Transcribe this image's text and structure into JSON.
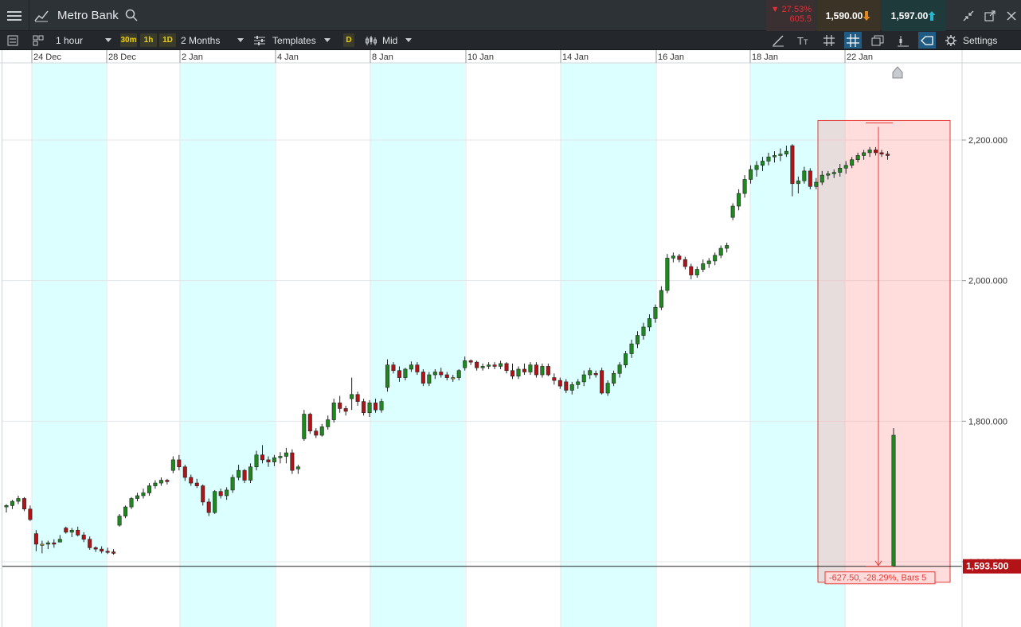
{
  "header": {
    "instrument": "Metro Bank",
    "change_pct": "▼ 27.53%",
    "change_abs": "605.5",
    "sell_price": "1,590.00",
    "buy_price": "1,597.00"
  },
  "toolbar": {
    "interval": "1 hour",
    "tf_30m": "30m",
    "tf_1h": "1h",
    "tf_1d": "1D",
    "range": "2 Months",
    "templates": "Templates",
    "d_badge": "D",
    "price_mode": "Mid",
    "settings": "Settings"
  },
  "chart_data": {
    "type": "candlestick",
    "x_tick_labels": [
      "24 Dec",
      "28 Dec",
      "2 Jan",
      "4 Jan",
      "8 Jan",
      "10 Jan",
      "14 Jan",
      "16 Jan",
      "18 Jan",
      "22 Jan"
    ],
    "y_tick_labels": [
      "2,200.000",
      "2,000.000",
      "1,800.000",
      "1,600.000"
    ],
    "y_ticks": [
      2200,
      2000,
      1800,
      1600
    ],
    "ylim": [
      1510,
      2310
    ],
    "current_price": 1593.5,
    "current_price_label": "1,593.500",
    "measurement": {
      "label": "-627.50, -28.29%, Bars 5",
      "from": 2221,
      "to": 1593.5
    },
    "colors": {
      "up": "#1e8a1e",
      "down": "#b31217",
      "doji": "#d4a020",
      "highlight": "#dcffff",
      "measure": "#e53935"
    },
    "candles": [
      [
        1678,
        1682,
        1670,
        1680
      ],
      [
        1680,
        1688,
        1675,
        1686
      ],
      [
        1686,
        1694,
        1682,
        1690
      ],
      [
        1690,
        1692,
        1672,
        1675
      ],
      [
        1675,
        1680,
        1658,
        1660
      ],
      [
        1640,
        1645,
        1615,
        1625
      ],
      [
        1625,
        1630,
        1612,
        1625
      ],
      [
        1625,
        1630,
        1618,
        1627
      ],
      [
        1627,
        1632,
        1620,
        1625
      ],
      [
        1628,
        1638,
        1630,
        1632
      ],
      [
        1648,
        1650,
        1640,
        1642
      ],
      [
        1642,
        1648,
        1635,
        1645
      ],
      [
        1645,
        1650,
        1636,
        1638
      ],
      [
        1638,
        1642,
        1628,
        1632
      ],
      [
        1632,
        1636,
        1617,
        1620
      ],
      [
        1620,
        1622,
        1614,
        1618
      ],
      [
        1618,
        1622,
        1612,
        1615
      ],
      [
        1615,
        1620,
        1611,
        1614
      ],
      [
        1614,
        1618,
        1610,
        1612
      ],
      [
        1652,
        1668,
        1650,
        1665
      ],
      [
        1665,
        1680,
        1662,
        1678
      ],
      [
        1678,
        1692,
        1675,
        1690
      ],
      [
        1690,
        1698,
        1686,
        1694
      ],
      [
        1694,
        1704,
        1690,
        1698
      ],
      [
        1698,
        1712,
        1694,
        1708
      ],
      [
        1708,
        1716,
        1704,
        1712
      ],
      [
        1712,
        1720,
        1708,
        1716
      ],
      [
        1716,
        1718,
        1710,
        1714
      ],
      [
        1730,
        1750,
        1726,
        1745
      ],
      [
        1745,
        1752,
        1730,
        1735
      ],
      [
        1735,
        1738,
        1715,
        1720
      ],
      [
        1720,
        1724,
        1708,
        1712
      ],
      [
        1712,
        1718,
        1705,
        1708
      ],
      [
        1708,
        1710,
        1680,
        1685
      ],
      [
        1685,
        1690,
        1665,
        1670
      ],
      [
        1670,
        1702,
        1668,
        1700
      ],
      [
        1700,
        1704,
        1690,
        1694
      ],
      [
        1694,
        1706,
        1688,
        1702
      ],
      [
        1702,
        1724,
        1698,
        1720
      ],
      [
        1720,
        1738,
        1716,
        1730
      ],
      [
        1730,
        1732,
        1712,
        1716
      ],
      [
        1716,
        1740,
        1712,
        1735
      ],
      [
        1735,
        1758,
        1730,
        1752
      ],
      [
        1752,
        1766,
        1740,
        1745
      ],
      [
        1745,
        1750,
        1735,
        1742
      ],
      [
        1742,
        1752,
        1736,
        1748
      ],
      [
        1748,
        1756,
        1740,
        1750
      ],
      [
        1750,
        1762,
        1740,
        1755
      ],
      [
        1755,
        1760,
        1725,
        1730
      ],
      [
        1732,
        1738,
        1725,
        1735
      ],
      [
        1775,
        1816,
        1772,
        1810
      ],
      [
        1810,
        1812,
        1782,
        1786
      ],
      [
        1786,
        1790,
        1776,
        1780
      ],
      [
        1780,
        1796,
        1778,
        1792
      ],
      [
        1792,
        1808,
        1788,
        1802
      ],
      [
        1802,
        1832,
        1798,
        1826
      ],
      [
        1826,
        1836,
        1812,
        1818
      ],
      [
        1818,
        1822,
        1808,
        1814
      ],
      [
        1832,
        1862,
        1816,
        1838
      ],
      [
        1838,
        1842,
        1822,
        1828
      ],
      [
        1828,
        1832,
        1808,
        1812
      ],
      [
        1812,
        1830,
        1806,
        1826
      ],
      [
        1826,
        1832,
        1812,
        1816
      ],
      [
        1816,
        1832,
        1812,
        1828
      ],
      [
        1848,
        1888,
        1842,
        1880
      ],
      [
        1880,
        1884,
        1868,
        1872
      ],
      [
        1872,
        1878,
        1856,
        1862
      ],
      [
        1862,
        1876,
        1858,
        1874
      ],
      [
        1874,
        1885,
        1870,
        1880
      ],
      [
        1880,
        1884,
        1866,
        1870
      ],
      [
        1870,
        1874,
        1850,
        1854
      ],
      [
        1854,
        1870,
        1850,
        1866
      ],
      [
        1866,
        1874,
        1860,
        1870
      ],
      [
        1870,
        1876,
        1862,
        1866
      ],
      [
        1866,
        1870,
        1858,
        1862
      ],
      [
        1862,
        1866,
        1856,
        1862
      ],
      [
        1862,
        1874,
        1858,
        1872
      ],
      [
        1876,
        1892,
        1872,
        1886
      ],
      [
        1886,
        1888,
        1880,
        1884
      ],
      [
        1884,
        1886,
        1872,
        1876
      ],
      [
        1876,
        1882,
        1872,
        1878
      ],
      [
        1878,
        1884,
        1874,
        1880
      ],
      [
        1880,
        1884,
        1874,
        1878
      ],
      [
        1878,
        1886,
        1874,
        1882
      ],
      [
        1882,
        1884,
        1868,
        1872
      ],
      [
        1872,
        1882,
        1860,
        1864
      ],
      [
        1864,
        1878,
        1860,
        1874
      ],
      [
        1874,
        1882,
        1866,
        1870
      ],
      [
        1870,
        1884,
        1866,
        1880
      ],
      [
        1880,
        1884,
        1862,
        1866
      ],
      [
        1866,
        1882,
        1862,
        1878
      ],
      [
        1878,
        1882,
        1864,
        1866
      ],
      [
        1862,
        1868,
        1852,
        1858
      ],
      [
        1858,
        1862,
        1846,
        1850
      ],
      [
        1856,
        1860,
        1840,
        1844
      ],
      [
        1844,
        1856,
        1838,
        1852
      ],
      [
        1852,
        1860,
        1846,
        1856
      ],
      [
        1856,
        1872,
        1850,
        1866
      ],
      [
        1866,
        1876,
        1860,
        1872
      ],
      [
        1868,
        1872,
        1862,
        1866
      ],
      [
        1872,
        1876,
        1838,
        1840
      ],
      [
        1840,
        1858,
        1836,
        1854
      ],
      [
        1854,
        1872,
        1850,
        1868
      ],
      [
        1868,
        1884,
        1862,
        1880
      ],
      [
        1880,
        1900,
        1876,
        1896
      ],
      [
        1896,
        1916,
        1890,
        1910
      ],
      [
        1910,
        1928,
        1904,
        1922
      ],
      [
        1922,
        1940,
        1916,
        1934
      ],
      [
        1934,
        1952,
        1928,
        1946
      ],
      [
        1946,
        1966,
        1940,
        1962
      ],
      [
        1962,
        1992,
        1958,
        1986
      ],
      [
        1986,
        2038,
        1982,
        2032
      ],
      [
        2032,
        2040,
        2026,
        2035
      ],
      [
        2035,
        2038,
        2026,
        2030
      ],
      [
        2030,
        2034,
        2016,
        2020
      ],
      [
        2020,
        2024,
        2002,
        2008
      ],
      [
        2008,
        2020,
        2004,
        2016
      ],
      [
        2016,
        2030,
        2012,
        2024
      ],
      [
        2024,
        2032,
        2018,
        2028
      ],
      [
        2028,
        2040,
        2022,
        2036
      ],
      [
        2036,
        2050,
        2032,
        2046
      ],
      [
        2046,
        2054,
        2040,
        2050
      ],
      [
        2090,
        2110,
        2086,
        2106
      ],
      [
        2106,
        2130,
        2100,
        2124
      ],
      [
        2124,
        2150,
        2118,
        2144
      ],
      [
        2144,
        2164,
        2138,
        2158
      ],
      [
        2158,
        2170,
        2148,
        2164
      ],
      [
        2164,
        2176,
        2156,
        2170
      ],
      [
        2170,
        2182,
        2164,
        2176
      ],
      [
        2176,
        2184,
        2168,
        2178
      ],
      [
        2178,
        2188,
        2170,
        2180
      ],
      [
        2180,
        2192,
        2176,
        2184
      ],
      [
        2192,
        2194,
        2120,
        2138
      ],
      [
        2138,
        2148,
        2124,
        2142
      ],
      [
        2142,
        2162,
        2138,
        2156
      ],
      [
        2156,
        2160,
        2130,
        2134
      ],
      [
        2134,
        2146,
        2130,
        2140
      ],
      [
        2140,
        2156,
        2136,
        2150
      ],
      [
        2150,
        2156,
        2144,
        2152
      ],
      [
        2152,
        2158,
        2146,
        2154
      ],
      [
        2154,
        2166,
        2148,
        2160
      ],
      [
        2160,
        2170,
        2152,
        2164
      ],
      [
        2164,
        2176,
        2160,
        2172
      ],
      [
        2172,
        2182,
        2168,
        2178
      ],
      [
        2178,
        2186,
        2172,
        2182
      ],
      [
        2182,
        2190,
        2176,
        2186
      ],
      [
        2186,
        2190,
        2178,
        2182
      ],
      [
        2182,
        2186,
        2176,
        2180
      ],
      [
        2180,
        2184,
        2172,
        2178
      ],
      [
        1593.5,
        1790,
        1593.5,
        1780
      ]
    ]
  }
}
